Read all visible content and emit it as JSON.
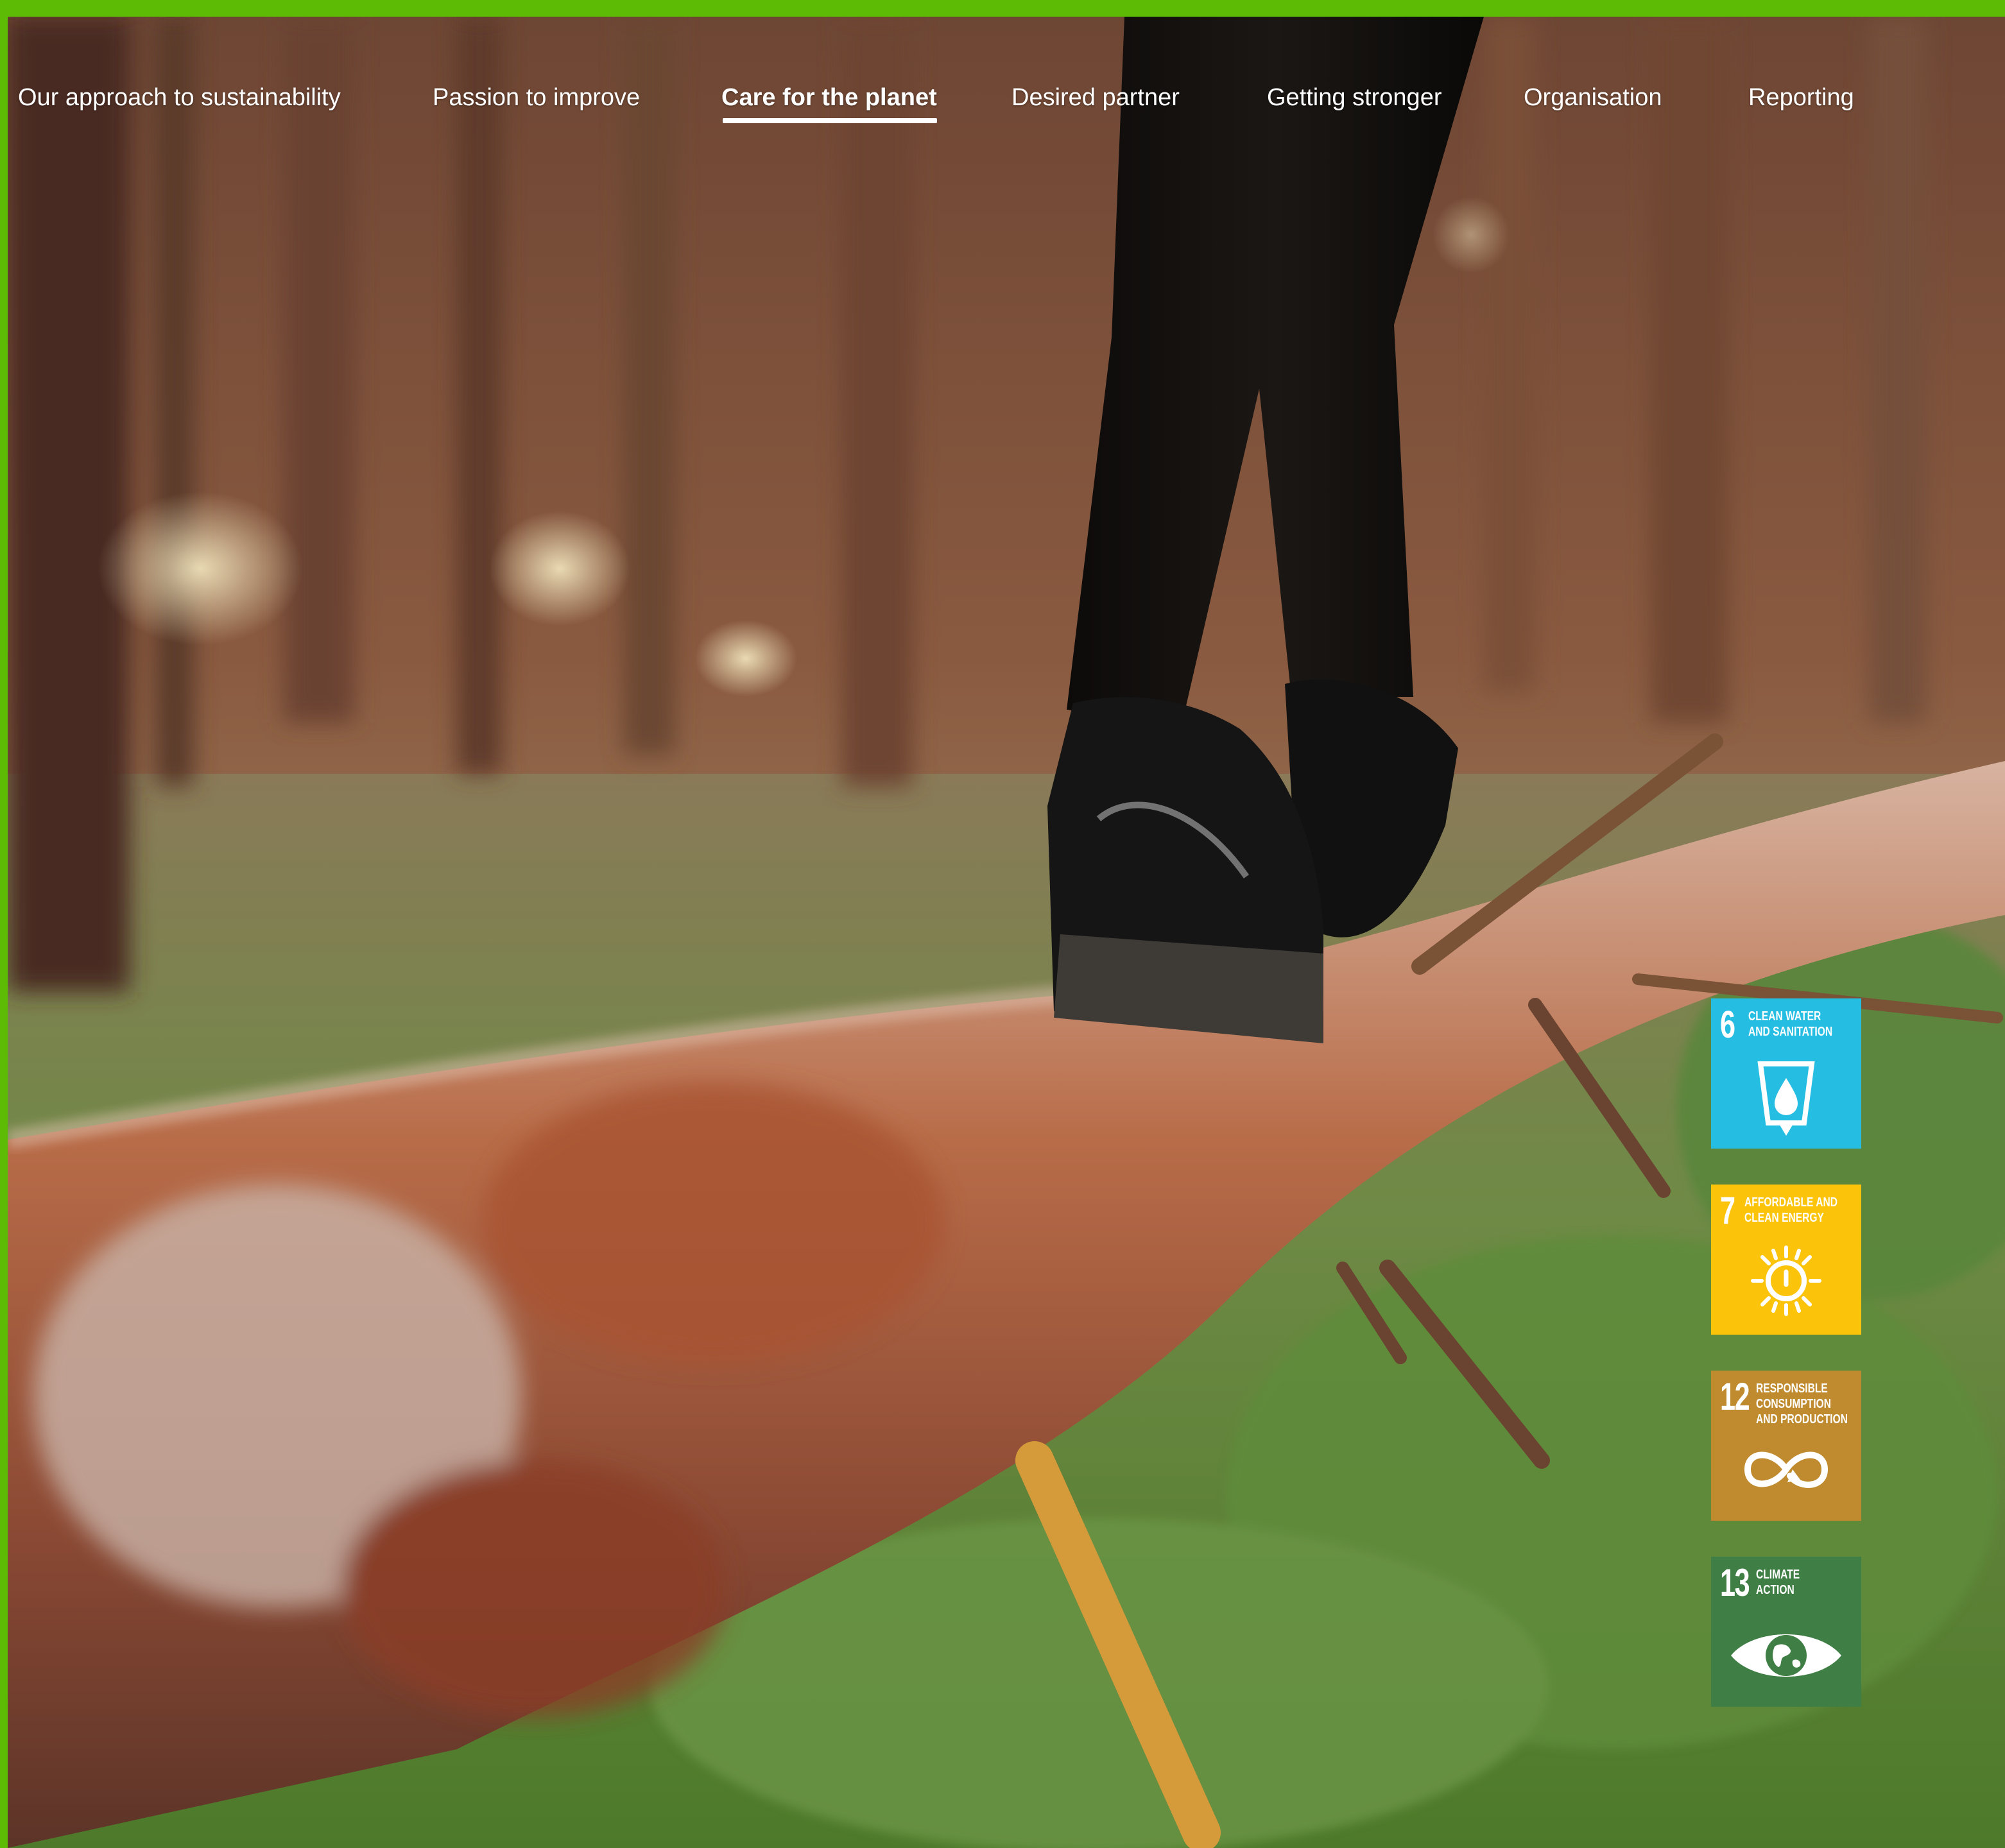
{
  "nav": {
    "items": [
      {
        "label": "Our approach to sustainability",
        "active": false
      },
      {
        "label": "Passion to improve",
        "active": false
      },
      {
        "label": "Care for the planet",
        "active": true
      },
      {
        "label": "Desired partner",
        "active": false
      },
      {
        "label": "Getting stronger",
        "active": false
      },
      {
        "label": "Organisation",
        "active": false
      },
      {
        "label": "Reporting",
        "active": false
      }
    ]
  },
  "hero": {
    "icon": "forest-photo"
  },
  "sdg_goals": [
    {
      "number": "6",
      "title": "CLEAN WATER\nAND SANITATION",
      "color": "#26bde2",
      "icon": "water-glass-icon"
    },
    {
      "number": "7",
      "title": "AFFORDABLE AND\nCLEAN ENERGY",
      "color": "#fcc30b",
      "icon": "sun-power-icon"
    },
    {
      "number": "12",
      "title": "RESPONSIBLE\nCONSUMPTION\nAND PRODUCTION",
      "color": "#bf8b2e",
      "icon": "infinity-loop-icon"
    },
    {
      "number": "13",
      "title": "CLIMATE\nACTION",
      "color": "#3f7e44",
      "icon": "eye-globe-icon"
    }
  ]
}
